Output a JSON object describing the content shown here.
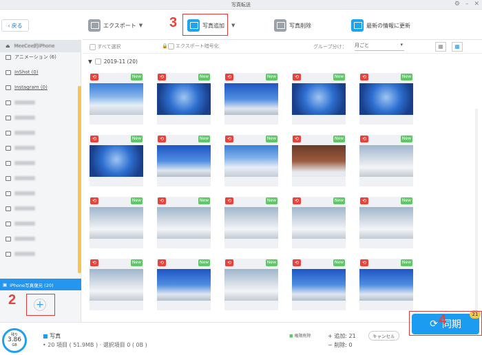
{
  "window": {
    "title": "写真転送"
  },
  "toolbar": {
    "back": "戻る",
    "export": "エクスポート",
    "add_photo": "写真追加",
    "delete_photo": "写真削除",
    "refresh": "最新の情報に更新"
  },
  "sidebar": {
    "device": "MeeCee的iPhone",
    "items": [
      "アニメーション (6)",
      "InShot (0)",
      "Instagram (0)"
    ],
    "blurred_count": 11,
    "active": "iPhone写真復元 (20)"
  },
  "filter": {
    "select_all": "すべて選択",
    "export_encrypt": "エクスポート暗号化",
    "group_by_label": "グループ分け：",
    "group_by_value": "月ごと"
  },
  "content": {
    "date_group": "2019-11 (20)",
    "new_label": "New"
  },
  "thumb_variants": [
    "v1",
    "v3",
    "v2",
    "v3",
    "v3",
    "v3",
    "v2",
    "v1",
    "v4",
    "v5",
    "v5",
    "v5",
    "v5",
    "v5",
    "v5",
    "v5",
    "v2",
    "v5",
    "v2",
    "v2"
  ],
  "bottom": {
    "storage_label": "残り",
    "storage_value": "3.86",
    "storage_unit": "GB",
    "photos": "写真",
    "items": "20 項目 ( 51.9MB )",
    "selected": "選択項目 0 ( 0B )",
    "delete_tag": "権限削除",
    "added_label": "追加:",
    "added_value": "21",
    "removed_label": "削除:",
    "removed_value": "0",
    "cancel": "キャンセル",
    "sync": "同期",
    "sync_badge": "21"
  },
  "steps": {
    "s2": "2",
    "s3": "3",
    "s4": "4"
  },
  "colors": {
    "accent": "#1c9cf0",
    "red": "#e8423a",
    "new_green": "#62c56a",
    "scroll_yellow": "#f6c451"
  }
}
